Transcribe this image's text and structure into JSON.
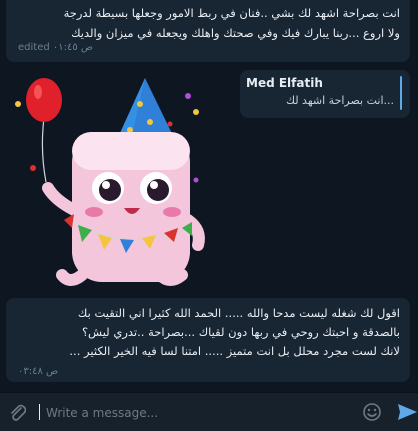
{
  "messages": [
    {
      "text": "انت بصراحة اشهد لك بشي ..فنان في ربط الامور وجعلها بسيطة لدرجة\nولا اروع ...ربنا يبارك فيك وفي صحتك واهلك ويجعله في ميزان والديك",
      "meta": "ص ٠١:٤٥ edited"
    },
    {
      "reply_name": "Med Elfatih",
      "reply_text": "...انت بصراحة اشهد لك"
    },
    {
      "text": "اقول لك شغله ليست مدحا والله ..... الحمد الله كثيرا اني التقيت بك\nبالصدقة و احبتك روحي في ربها دون لقياك ...بصراحة ..تدري ليش؟\nلانك لست مجرد محلل بل انت متميز ..... امتنا لسا فيه الخير الكثير ...",
      "meta": "ص ٠٣:٤٨"
    }
  ],
  "composer": {
    "placeholder": "Write a message..."
  },
  "icons": {
    "attach": "paperclip-icon",
    "emoji": "smiley-icon",
    "send": "send-icon"
  },
  "colors": {
    "background": "#0e1621",
    "bubble": "#182533",
    "composer": "#17212b",
    "accent": "#5fa9e6"
  }
}
